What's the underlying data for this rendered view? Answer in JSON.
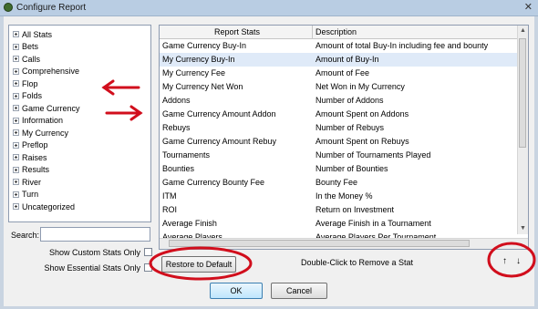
{
  "window": {
    "title": "Configure Report",
    "close_glyph": "✕"
  },
  "tree": {
    "items": [
      "All Stats",
      "Bets",
      "Calls",
      "Comprehensive",
      "Flop",
      "Folds",
      "Game Currency",
      "Information",
      "My Currency",
      "Preflop",
      "Raises",
      "Results",
      "River",
      "Turn",
      "Uncategorized"
    ]
  },
  "search": {
    "label": "Search:",
    "value": ""
  },
  "options": {
    "custom_only": "Show Custom Stats Only",
    "essential_only": "Show Essential Stats Only"
  },
  "table": {
    "headers": {
      "stat": "Report Stats",
      "desc": "Description"
    },
    "rows": [
      {
        "stat": "Game Currency Buy-In",
        "desc": "Amount of total Buy-In including fee and bounty"
      },
      {
        "stat": "My Currency Buy-In",
        "desc": "Amount of Buy-In"
      },
      {
        "stat": "My Currency Fee",
        "desc": "Amount of Fee"
      },
      {
        "stat": "My Currency Net Won",
        "desc": "Net Won in My Currency"
      },
      {
        "stat": "Addons",
        "desc": "Number of Addons"
      },
      {
        "stat": "Game Currency Amount Addon",
        "desc": "Amount Spent on Addons"
      },
      {
        "stat": "Rebuys",
        "desc": "Number of Rebuys"
      },
      {
        "stat": "Game Currency Amount Rebuy",
        "desc": "Amount Spent on Rebuys"
      },
      {
        "stat": "Tournaments",
        "desc": "Number of Tournaments Played"
      },
      {
        "stat": "Bounties",
        "desc": "Number of Bounties"
      },
      {
        "stat": "Game Currency Bounty Fee",
        "desc": "Bounty Fee"
      },
      {
        "stat": "ITM",
        "desc": "In the Money %"
      },
      {
        "stat": "ROI",
        "desc": "Return on Investment"
      },
      {
        "stat": "Average Finish",
        "desc": "Average Finish in a Tournament"
      },
      {
        "stat": "Average Players",
        "desc": "Average Players Per Tournament"
      }
    ],
    "selected_index": 1
  },
  "buttons": {
    "restore": "Restore to Default",
    "ok": "OK",
    "cancel": "Cancel",
    "move_up": "↑",
    "move_down": "↓"
  },
  "hint": "Double-Click to Remove a Stat",
  "annotations": {
    "arrow_glyph": "⟵",
    "arrow_right_glyph": "⟶",
    "color": "#d10e1c"
  },
  "colors": {
    "selected_row": "#dfeaf8",
    "titlebar": "#b9cde3"
  }
}
